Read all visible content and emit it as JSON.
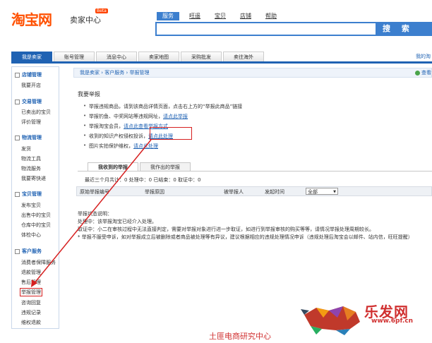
{
  "header": {
    "logo": "淘宝网",
    "subtitle": "卖家中心",
    "badge": "Beta",
    "search_tabs": [
      "服务",
      "旺遥",
      "宝贝",
      "店铺",
      "帮助"
    ],
    "search_button": "搜 索"
  },
  "nav": {
    "items": [
      "我是卖家",
      "账号管理",
      "消息中心",
      "卖家地图",
      "采购批发",
      "卖往海外"
    ],
    "right": "我的淘"
  },
  "sidebar": {
    "groups": [
      {
        "title": "店铺管理",
        "items": [
          "我要开店"
        ]
      },
      {
        "title": "交易管理",
        "items": [
          "已卖出的宝贝",
          "评价管理"
        ]
      },
      {
        "title": "物流管理",
        "items": [
          "发货",
          "物流工具",
          "物流服务",
          "我要寄快递"
        ]
      },
      {
        "title": "宝贝管理",
        "items": [
          "发布宝贝",
          "出售中的宝贝",
          "仓库中的宝贝",
          "体检中心"
        ]
      },
      {
        "title": "客户服务",
        "items": [
          "消费者保障服务",
          "退款管理",
          "售后管理",
          "举报管理",
          "咨询回复",
          "违规记录",
          "维权退款"
        ]
      }
    ]
  },
  "breadcrumb": "我是卖家 › 客户服务 › 举报管理",
  "help_label": "查看",
  "main": {
    "section_title": "我要举报",
    "bullets": [
      {
        "text": "举报违规商品，请到该商品详情页面，点击右上方的“举报此商品”链接",
        "link": ""
      },
      {
        "text": "举报钓鱼、中奖网站等违规网址，",
        "link": "请点此举报"
      },
      {
        "text": "举报淘宝会员，",
        "link": "请点此查看举报方式"
      },
      {
        "text": "收到的知识产权侵权投诉，",
        "link": "请点此处理"
      },
      {
        "text": "图片实拍保护维权，",
        "link": "请点此处理"
      }
    ],
    "tabs": [
      "我收到的举报",
      "我作出的举报"
    ],
    "stats": "最近三个月共计：0    处理中：0    已结束：0    取证中：0",
    "columns": [
      "原始举报编号",
      "举报原因",
      "被举报人",
      "发起时间"
    ],
    "select_value": "全部",
    "notes": [
      "举报状态说明：",
      "处理中：该举报淘宝已经介入处理。",
      "取证中：小二在审核过程中无法直接判定，需要对举报对象进行进一步取证，如进行到举报审核的购买等等，请情况举报处理周期较长。",
      "* 举报不服受申诉，如对举报成立后被删除或者商品被处理等有异议，建议根据相应的违规处理情况申诉（违规处理后淘宝会以邮件、站内信，旺旺提醒）"
    ]
  },
  "footer": "土匪电商研究中心",
  "watermark": {
    "text": "乐发网",
    "url": "www.6pf.cn"
  },
  "colors": {
    "accent": "#1f62b3",
    "highlight": "#d62020",
    "logo": "#ff5000"
  }
}
